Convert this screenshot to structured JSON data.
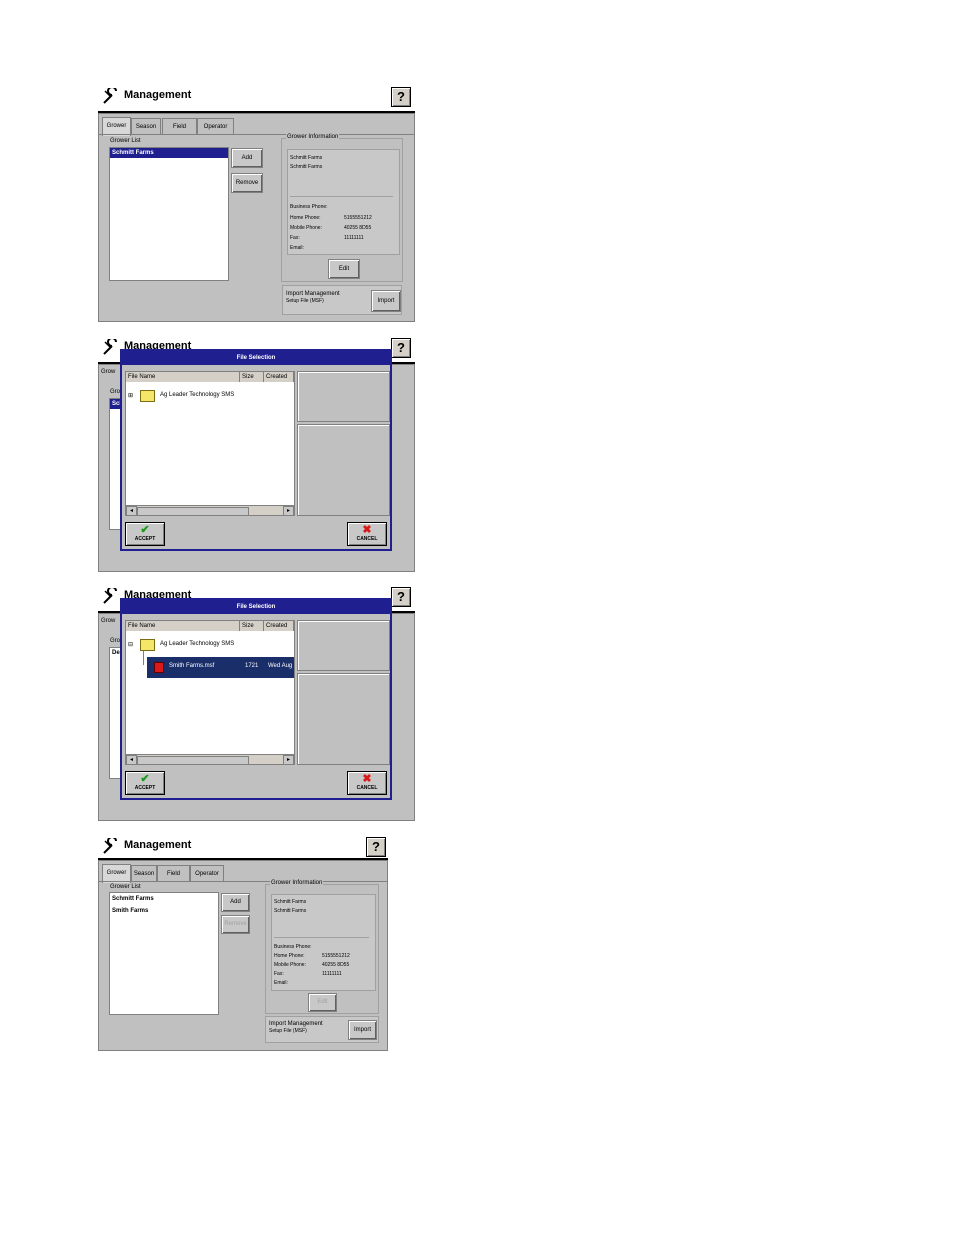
{
  "app_title": "Management",
  "help_label": "?",
  "tabs": [
    "Grower",
    "Season",
    "Field",
    "Operator"
  ],
  "grower_list_label": "Grower List",
  "grower_info_label": "Grower Information",
  "add_label": "Add",
  "remove_label": "Remove",
  "edit_label": "Edit",
  "import_label": "Import",
  "import_text_line1": "Import Management",
  "import_text_line2": "Setup File (MSF)",
  "grower_name": "Schmitt Farms",
  "grower_name2": "Smith Farms",
  "info": {
    "name1": "Schmitt Farms",
    "name2": "Schmitt Farms",
    "business_phone_label": "Business Phone:",
    "home_phone_label": "Home Phone:",
    "home_phone": "5155551212",
    "mobile_phone_label": "Mobile Phone:",
    "mobile_phone": "40255 8D55",
    "fax_label": "Fax:",
    "fax": "11111111",
    "email_label": "Email:"
  },
  "dialog": {
    "title": "File Selection",
    "col_file_name": "File Name",
    "col_size": "Size",
    "col_created": "Created",
    "folder_name": "Ag Leader Technology SMS",
    "file_name": "Smith Farms.msf",
    "file_size": "1721",
    "file_created": "Wed Aug",
    "accept_label": "ACCEPT",
    "cancel_label": "CANCEL"
  },
  "partial_labels": {
    "grower_tab_partial": "Grow",
    "grower_list_partial": "Grov",
    "sel_item_partial": "Sch",
    "item_partial": "Dea"
  },
  "colors": {
    "selection": "#1f1f8f",
    "dialog_border": "#1f1f8f",
    "accept_icon": "#1a9a1a",
    "cancel_icon": "#d81a1a",
    "file_icon": "#d81a1a"
  }
}
